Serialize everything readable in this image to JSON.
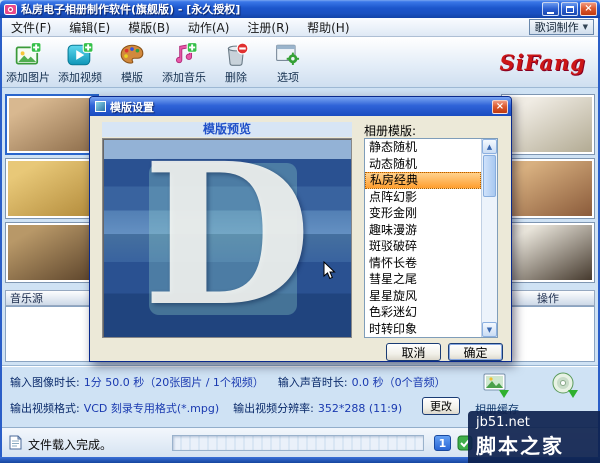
{
  "window": {
    "title": "私房电子相册制作软件(旗舰版) - [永久授权]"
  },
  "menu": {
    "items": [
      "文件(F)",
      "编辑(E)",
      "模版(B)",
      "动作(A)",
      "注册(R)",
      "帮助(H)"
    ],
    "lyrics_dropdown": "歌词制作"
  },
  "toolbar": {
    "logo": "SiFang",
    "buttons": [
      {
        "label": "添加图片",
        "icon": "add-image-icon"
      },
      {
        "label": "添加视频",
        "icon": "add-video-icon"
      },
      {
        "label": "模版",
        "icon": "template-icon"
      },
      {
        "label": "添加音乐",
        "icon": "add-music-icon"
      },
      {
        "label": "删除",
        "icon": "delete-icon"
      },
      {
        "label": "选项",
        "icon": "options-icon"
      }
    ]
  },
  "thumbnails": {
    "left": [
      {
        "c1": "#d8b890",
        "c2": "#8a6a48",
        "sel": true
      },
      {
        "c1": "#e8c878",
        "c2": "#b08838"
      },
      {
        "c1": "#b89868",
        "c2": "#584028"
      }
    ],
    "right": [
      {
        "c1": "#f0ece4",
        "c2": "#b0a890"
      },
      {
        "c1": "#d8b080",
        "c2": "#885838"
      },
      {
        "c1": "#e8e4da",
        "c2": "#403428"
      }
    ]
  },
  "panels": {
    "music_header": "音乐源",
    "action_header": "操作"
  },
  "dialog": {
    "title": "模版设置",
    "preview_label": "模版预览",
    "preview_letter": "D",
    "list_label": "相册模版:",
    "selected_index": 2,
    "templates": [
      "静态随机",
      "动态随机",
      "私房经典",
      "点阵幻影",
      "变形金刚",
      "趣味漫游",
      "斑驳破碎",
      "情怀长卷",
      "彗星之尾",
      "星星旋风",
      "色彩迷幻",
      "时转印象"
    ],
    "cancel_label": "取消",
    "ok_label": "确定"
  },
  "info": {
    "image_duration_label": "输入图像时长:",
    "image_duration_value": "1分 50.0 秒（20张图片 / 1个视频）",
    "sound_duration_label": "输入声音时长:",
    "sound_duration_value": "0.0 秒（0个音频）",
    "video_format_label": "输出视频格式:",
    "video_format_value": "VCD 刻录专用格式(*.mpg)",
    "resolution_label": "输出视频分辨率:",
    "resolution_value": "352*288 (11:9)",
    "change_label": "更改"
  },
  "quick_actions": {
    "album_cache_label": "相册缓存"
  },
  "statusbar": {
    "message": "文件载入完成。",
    "indicator": "1"
  },
  "watermark": {
    "site": "jb51.net",
    "name": "脚本之家"
  },
  "colors": {
    "titlebar_blue": "#1c56cc",
    "selection_orange": "#ff9e2e",
    "logo_red": "#cc1616"
  }
}
